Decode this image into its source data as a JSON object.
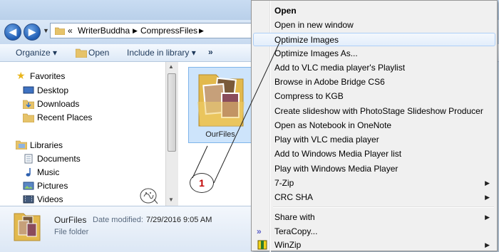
{
  "explorer": {
    "breadcrumb": [
      "WriterBuddha",
      "CompressFiles"
    ],
    "toolbar": {
      "organize": "Organize ▾",
      "open": "Open",
      "include": "Include in library ▾",
      "more": "»"
    },
    "favorites": {
      "title": "Favorites",
      "items": [
        "Desktop",
        "Downloads",
        "Recent Places"
      ]
    },
    "libraries": {
      "title": "Libraries",
      "items": [
        "Documents",
        "Music",
        "Pictures",
        "Videos"
      ]
    },
    "selected_file": {
      "name": "OurFiles",
      "modified_label": "Date modified:",
      "modified": "7/29/2016 9:05 AM",
      "type": "File folder"
    },
    "annotation": "1"
  },
  "context_menu": {
    "items": [
      {
        "label": "Open",
        "bold": true
      },
      {
        "label": "Open in new window"
      },
      {
        "label": "Optimize Images",
        "highlighted": true
      },
      {
        "label": "Optimize Images As..."
      },
      {
        "label": "Add to VLC media player's Playlist"
      },
      {
        "label": "Browse in Adobe Bridge CS6"
      },
      {
        "label": "Compress to KGB"
      },
      {
        "label": "Create slideshow with PhotoStage Slideshow Producer"
      },
      {
        "label": "Open as Notebook in OneNote"
      },
      {
        "label": "Play with VLC media player"
      },
      {
        "label": "Add to Windows Media Player list"
      },
      {
        "label": "Play with Windows Media Player"
      },
      {
        "label": "7-Zip",
        "submenu": true
      },
      {
        "label": "CRC SHA",
        "submenu": true
      },
      {
        "label": "Share with",
        "submenu": true
      },
      {
        "label": "TeraCopy...",
        "icon": "teracopy-icon"
      },
      {
        "label": "WinZip",
        "submenu": true,
        "icon": "winzip-icon"
      }
    ]
  },
  "colors": {
    "accent_red": "#c00000",
    "hover_border": "#aecff7",
    "nav_blue": "#1f5cb3"
  }
}
